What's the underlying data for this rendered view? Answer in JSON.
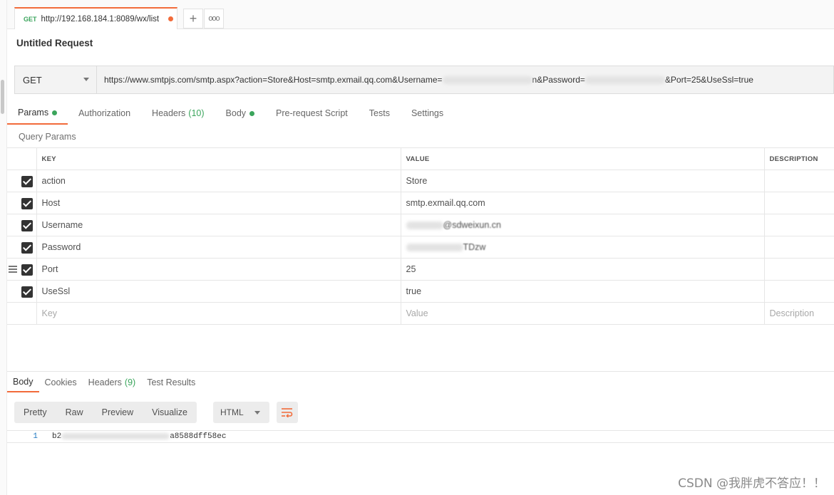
{
  "tab": {
    "method": "GET",
    "url": "http://192.168.184.1:8089/wx/list",
    "add_label": "+",
    "more_label": "ooo"
  },
  "request": {
    "title": "Untitled Request",
    "method": "GET",
    "url_visible_start": "https://www.smtpjs.com/smtp.aspx?action=Store&Host=smtp.exmail.qq.com&Username=",
    "url_mid1": "n&Password=",
    "url_end": "&Port=25&UseSsl=true"
  },
  "request_tabs": [
    {
      "label": "Params"
    },
    {
      "label": "Authorization"
    },
    {
      "label": "Headers",
      "count": "(10)"
    },
    {
      "label": "Body"
    },
    {
      "label": "Pre-request Script"
    },
    {
      "label": "Tests"
    },
    {
      "label": "Settings"
    }
  ],
  "query_params": {
    "label": "Query Params",
    "headers": [
      "KEY",
      "VALUE",
      "DESCRIPTION"
    ],
    "rows": [
      {
        "key": "action",
        "value": "Store",
        "checked": true
      },
      {
        "key": "Host",
        "value": "smtp.exmail.qq.com",
        "checked": true
      },
      {
        "key": "Username",
        "value": "@sdweixun.cn",
        "checked": true,
        "blurred": true
      },
      {
        "key": "Password",
        "value": "TDzw",
        "checked": true,
        "blurred": true
      },
      {
        "key": "Port",
        "value": "25",
        "checked": true
      },
      {
        "key": "UseSsl",
        "value": "true",
        "checked": true
      }
    ],
    "placeholder": {
      "key": "Key",
      "value": "Value",
      "description": "Description"
    }
  },
  "response_tabs": [
    {
      "label": "Body"
    },
    {
      "label": "Cookies"
    },
    {
      "label": "Headers",
      "count": "(9)"
    },
    {
      "label": "Test Results"
    }
  ],
  "response_toolbar": {
    "options": [
      "Pretty",
      "Raw",
      "Preview",
      "Visualize"
    ],
    "language": "HTML"
  },
  "response_body": {
    "line_number": "1",
    "code_start": "b2",
    "code_end": "a8588dff58ec"
  },
  "watermark": "CSDN @我胖虎不答应！！",
  "colors": {
    "accent": "#f26b3a",
    "green": "#3ba55c"
  }
}
